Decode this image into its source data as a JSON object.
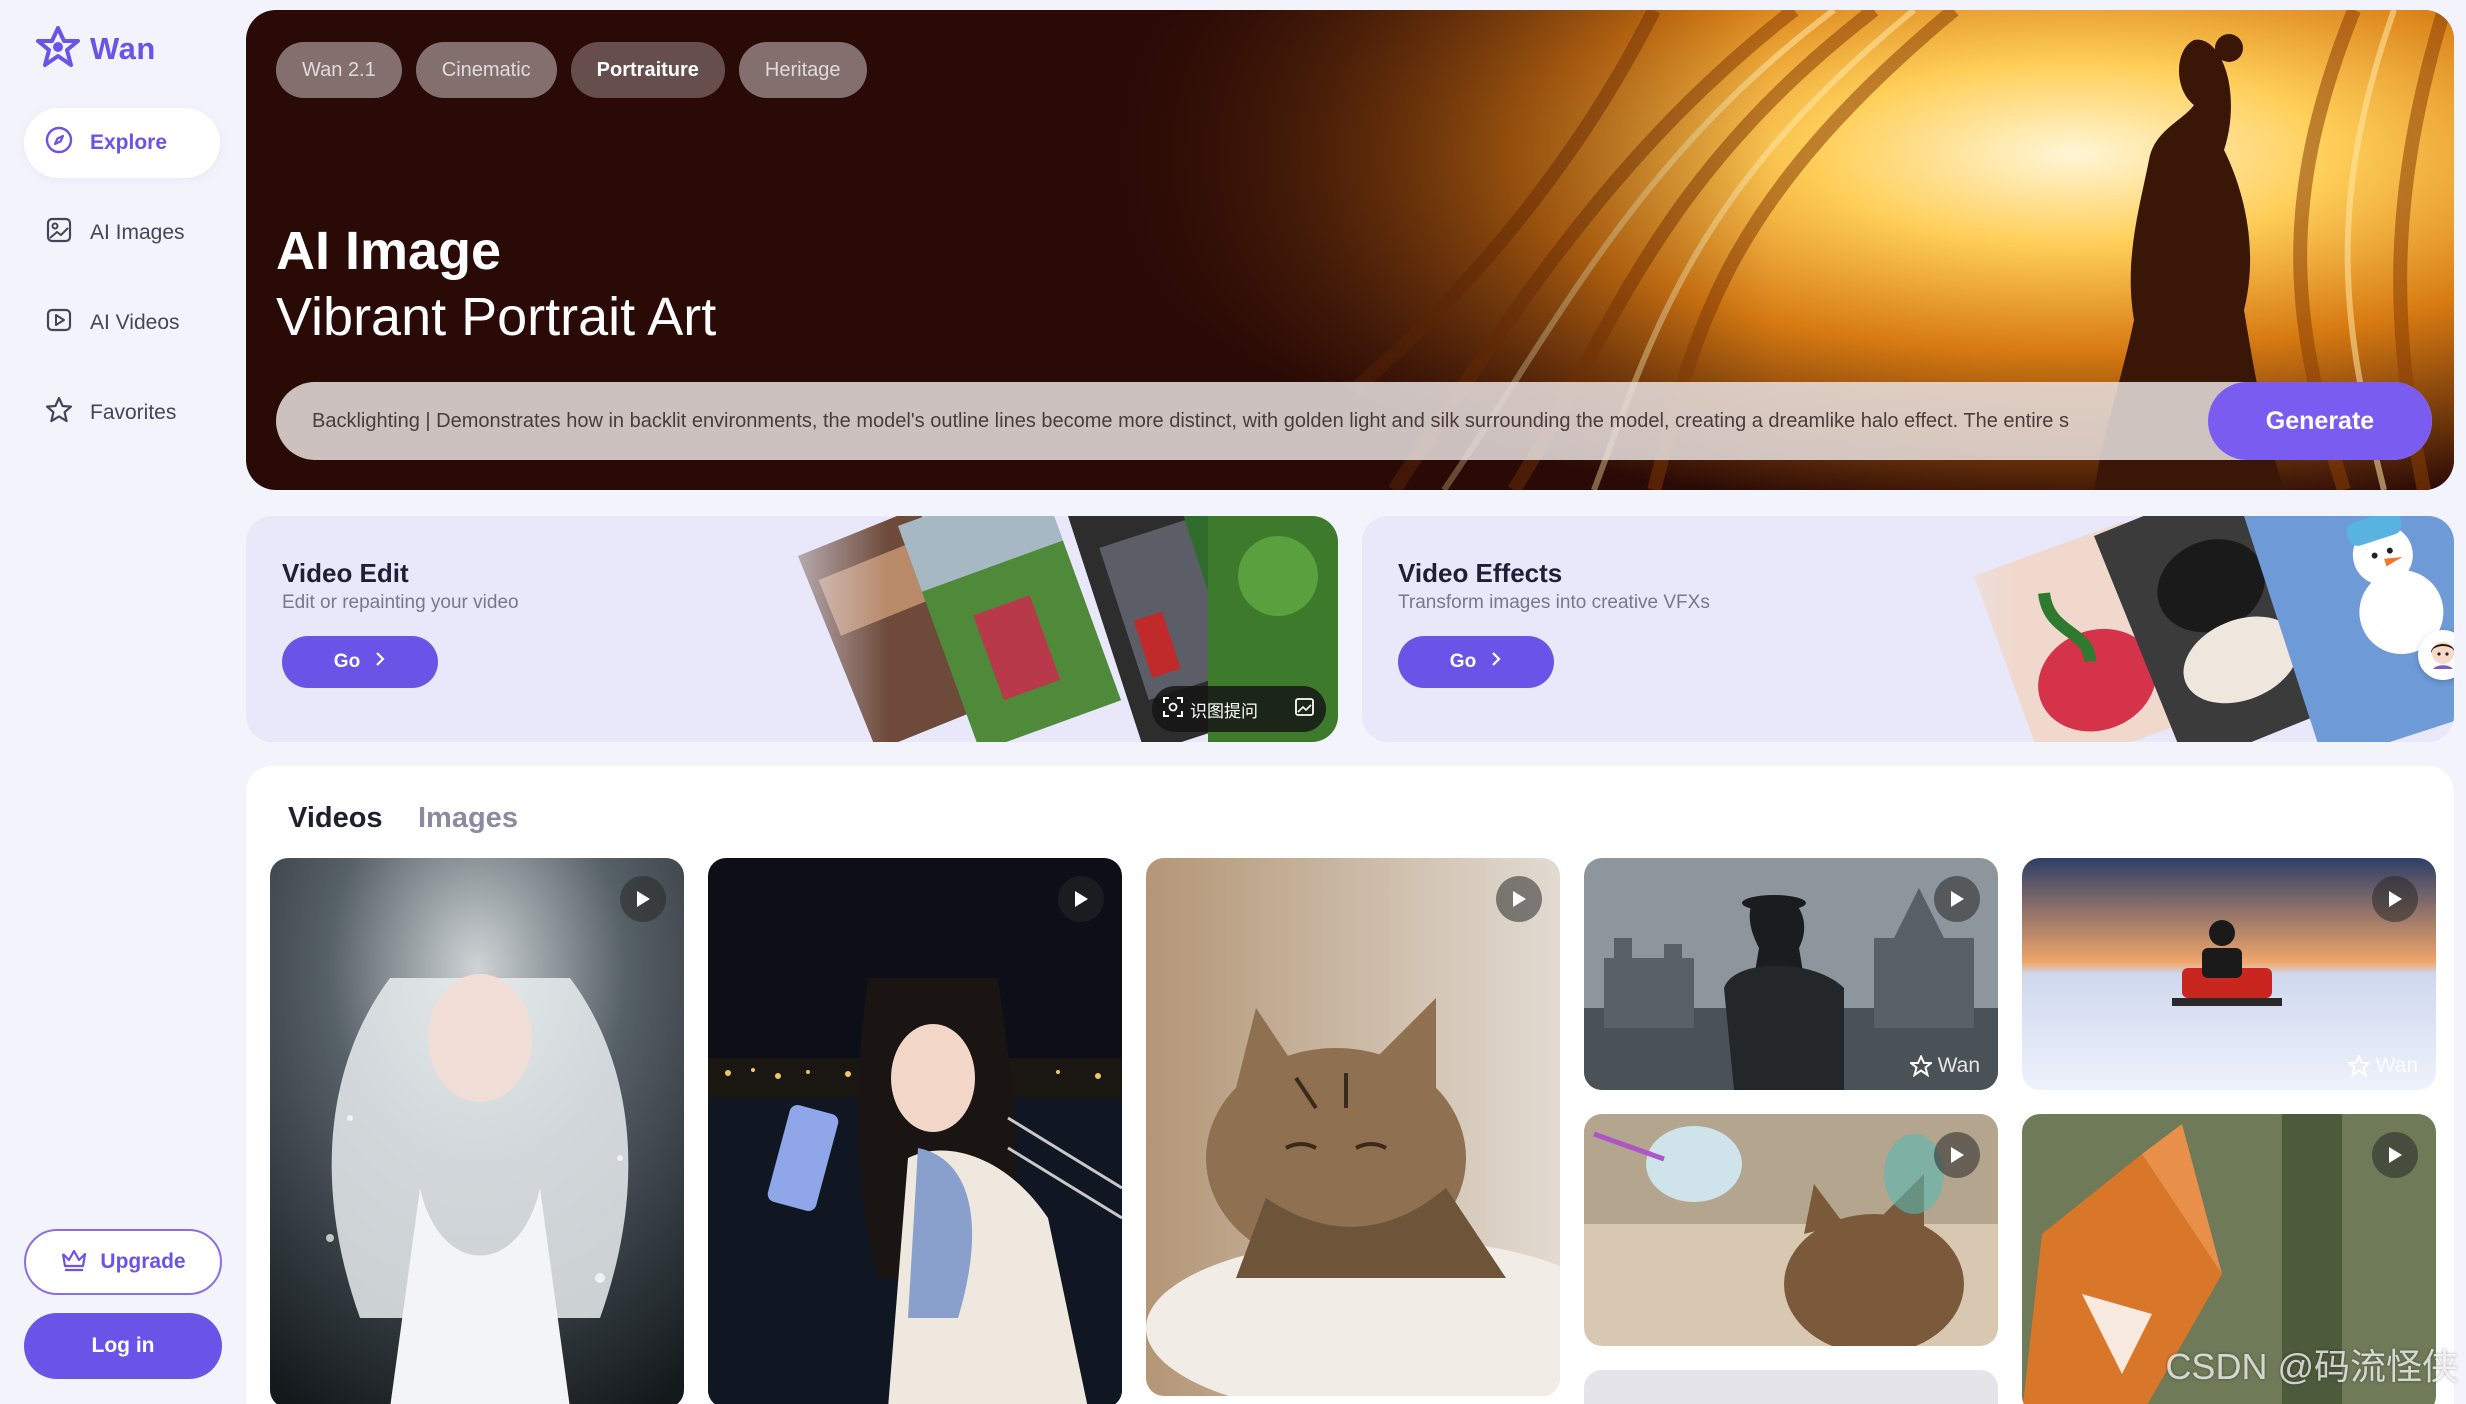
{
  "brand": {
    "name": "Wan"
  },
  "sidebar": {
    "items": [
      {
        "label": "Explore",
        "icon": "compass-icon",
        "active": true
      },
      {
        "label": "AI Images",
        "icon": "image-icon",
        "active": false
      },
      {
        "label": "AI Videos",
        "icon": "video-play-icon",
        "active": false
      },
      {
        "label": "Favorites",
        "icon": "star-icon",
        "active": false
      }
    ],
    "upgrade_label": "Upgrade",
    "login_label": "Log in"
  },
  "hero": {
    "tabs": [
      {
        "label": "Wan 2.1",
        "active": false
      },
      {
        "label": "Cinematic",
        "active": false
      },
      {
        "label": "Portraiture",
        "active": true
      },
      {
        "label": "Heritage",
        "active": false
      }
    ],
    "title": "AI Image",
    "subtitle": "Vibrant Portrait Art",
    "prompt": "Backlighting | Demonstrates how in backlit environments, the model's outline lines become more distinct, with golden light and silk surrounding the model, creating a dreamlike halo effect. The entire s",
    "generate_label": "Generate"
  },
  "features": {
    "video_edit": {
      "title": "Video Edit",
      "desc": "Edit or repainting your video",
      "go_label": "Go",
      "ocr_chip": "识图提问"
    },
    "video_effects": {
      "title": "Video Effects",
      "desc": "Transform images into creative VFXs",
      "go_label": "Go"
    }
  },
  "gallery": {
    "tabs": [
      {
        "label": "Videos",
        "active": true
      },
      {
        "label": "Images",
        "active": false
      }
    ],
    "watermark": "Wan"
  },
  "page_watermark": "CSDN @码流怪侠",
  "colors": {
    "accent": "#6a54e8",
    "generate": "#7b5cf0",
    "hero_bg": "#2a0a06",
    "page_bg": "#f3f3fb"
  }
}
